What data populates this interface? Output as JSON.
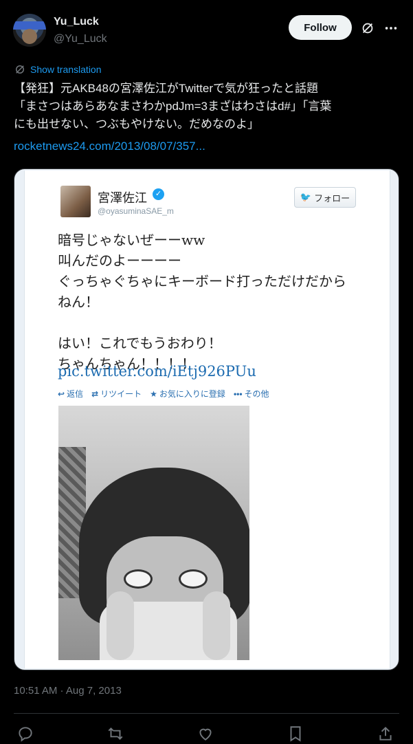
{
  "author": {
    "name": "Yu_Luck",
    "handle": "@Yu_Luck",
    "follow_label": "Follow"
  },
  "translation": {
    "label": "Show translation"
  },
  "tweet": {
    "text": "【発狂】元AKB48の宮澤佐江がTwitterで気が狂ったと話題\n「まさつはあらあなまさわかpdJm=3まざはわさはd#」「言葉\nにも出せない、つぶもやけない。だめなのよ」",
    "link": "rocketnews24.com/2013/08/07/357..."
  },
  "embedded": {
    "name": "宮澤佐江",
    "handle": "@oyasuminaSAE_m",
    "follow_label": "フォロー",
    "text": "暗号じゃないぜーーww\n叫んだのよーーーー\nぐっちゃぐちゃにキーボード打っただけだから\nねん！\n\nはい！これでもうおわり！\nちゃんちゃん！！！！",
    "link": "pic.twitter.com/iEtj926PUu",
    "actions": {
      "reply": "返信",
      "retweet": "リツイート",
      "favorite": "お気に入りに登録",
      "more": "その他"
    }
  },
  "meta": {
    "timestamp": "10:51 AM · Aug 7, 2013"
  },
  "colors": {
    "background": "#000000",
    "accent": "#1d9bf0",
    "secondary_text": "#71767b"
  }
}
